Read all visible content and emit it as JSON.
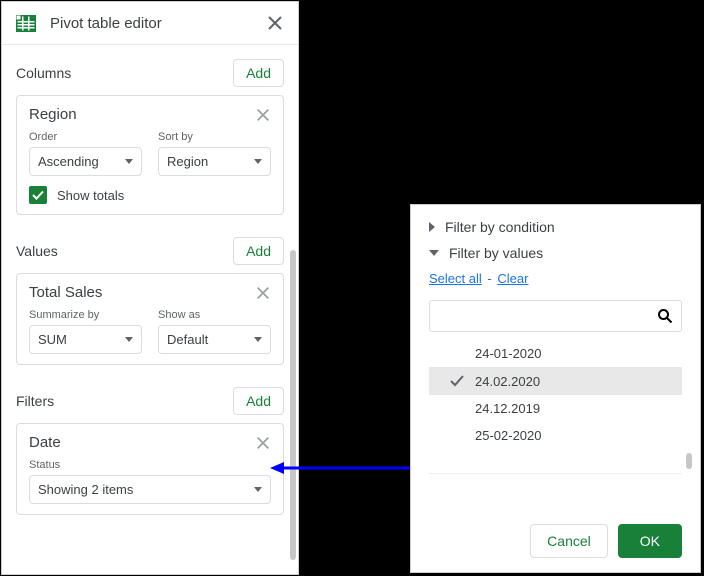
{
  "editor": {
    "title": "Pivot table editor",
    "columns": {
      "title": "Columns",
      "add": "Add",
      "card": {
        "name": "Region",
        "order_label": "Order",
        "order_value": "Ascending",
        "sort_label": "Sort by",
        "sort_value": "Region",
        "show_totals": "Show totals"
      }
    },
    "values": {
      "title": "Values",
      "add": "Add",
      "card": {
        "name": "Total Sales",
        "summarize_label": "Summarize by",
        "summarize_value": "SUM",
        "showas_label": "Show as",
        "showas_value": "Default"
      }
    },
    "filters": {
      "title": "Filters",
      "add": "Add",
      "card": {
        "name": "Date",
        "status_label": "Status",
        "status_value": "Showing 2 items"
      }
    }
  },
  "popup": {
    "filter_condition": "Filter by condition",
    "filter_values": "Filter by values",
    "select_all": "Select all",
    "clear": "Clear",
    "items": [
      {
        "text": "24-01-2020",
        "selected": false
      },
      {
        "text": "24.02.2020",
        "selected": true
      },
      {
        "text": "24.12.2019",
        "selected": false
      },
      {
        "text": "25-02-2020",
        "selected": false
      }
    ],
    "cancel": "Cancel",
    "ok": "OK"
  }
}
